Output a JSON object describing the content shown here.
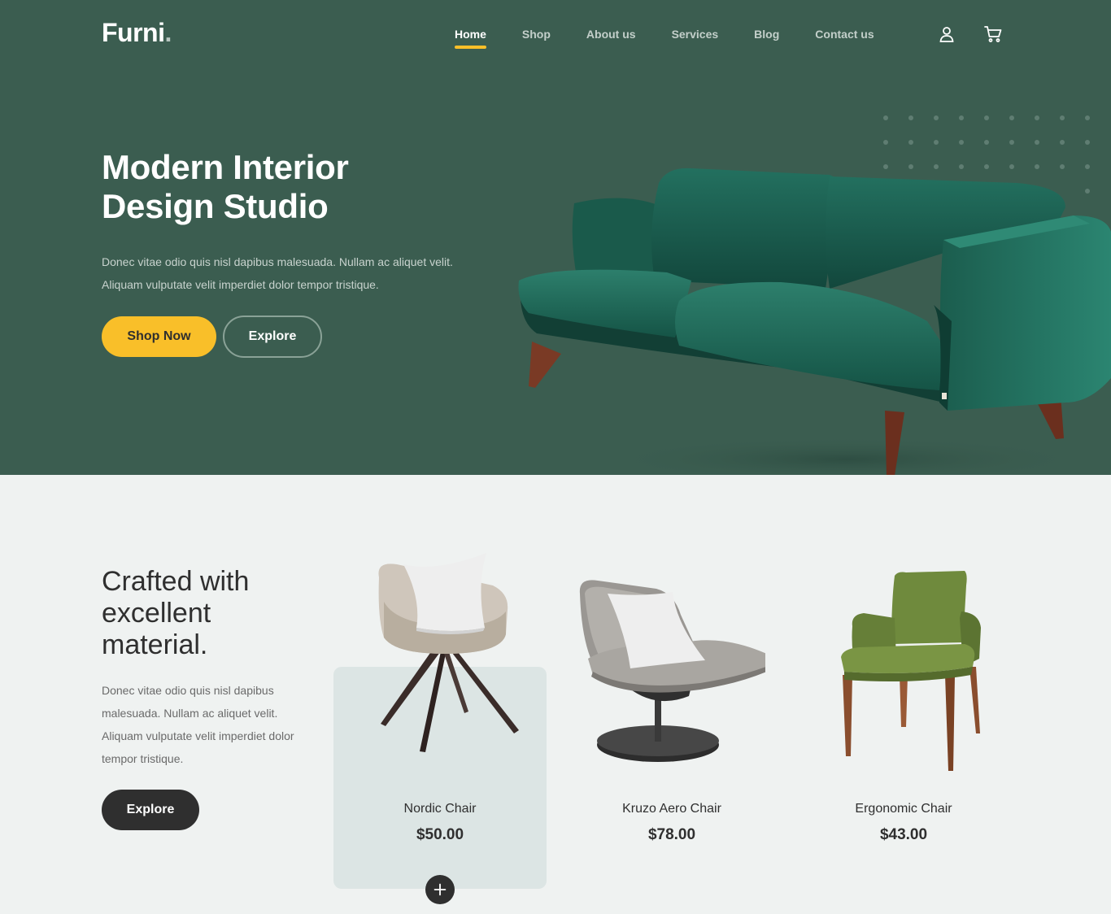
{
  "nav": {
    "logo": "Furni",
    "logo_dot": ".",
    "items": [
      {
        "label": "Home",
        "active": true
      },
      {
        "label": "Shop"
      },
      {
        "label": "About us"
      },
      {
        "label": "Services"
      },
      {
        "label": "Blog"
      },
      {
        "label": "Contact us"
      }
    ],
    "icons": [
      "user-icon",
      "cart-icon"
    ]
  },
  "hero": {
    "title_line1": "Modern Interior",
    "title_line2": "Design Studio",
    "text": "Donec vitae odio quis nisl dapibus malesuada. Nullam ac aliquet velit. Aliquam vulputate velit imperdiet dolor tempor tristique.",
    "primary_button": "Shop Now",
    "secondary_button": "Explore",
    "image": "green-sofa"
  },
  "products_section": {
    "title_line1": "Crafted with",
    "title_line2": "excellent",
    "title_line3": "material.",
    "text": "Donec vitae odio quis nisl dapibus malesuada. Nullam ac aliquet velit. Aliquam vulputate velit imperdiet dolor tempor tristique.",
    "button": "Explore",
    "products": [
      {
        "name": "Nordic Chair",
        "price": "$50.00",
        "image": "nordic-chair",
        "hovered": true
      },
      {
        "name": "Kruzo Aero Chair",
        "price": "$78.00",
        "image": "kruzo-aero-chair"
      },
      {
        "name": "Ergonomic Chair",
        "price": "$43.00",
        "image": "ergonomic-chair"
      }
    ]
  },
  "colors": {
    "hero_bg": "#3b5d50",
    "accent": "#f9bf29",
    "page_bg": "#eff2f1",
    "dark": "#2f2f2f",
    "card_hover_bg": "#dce5e4"
  }
}
